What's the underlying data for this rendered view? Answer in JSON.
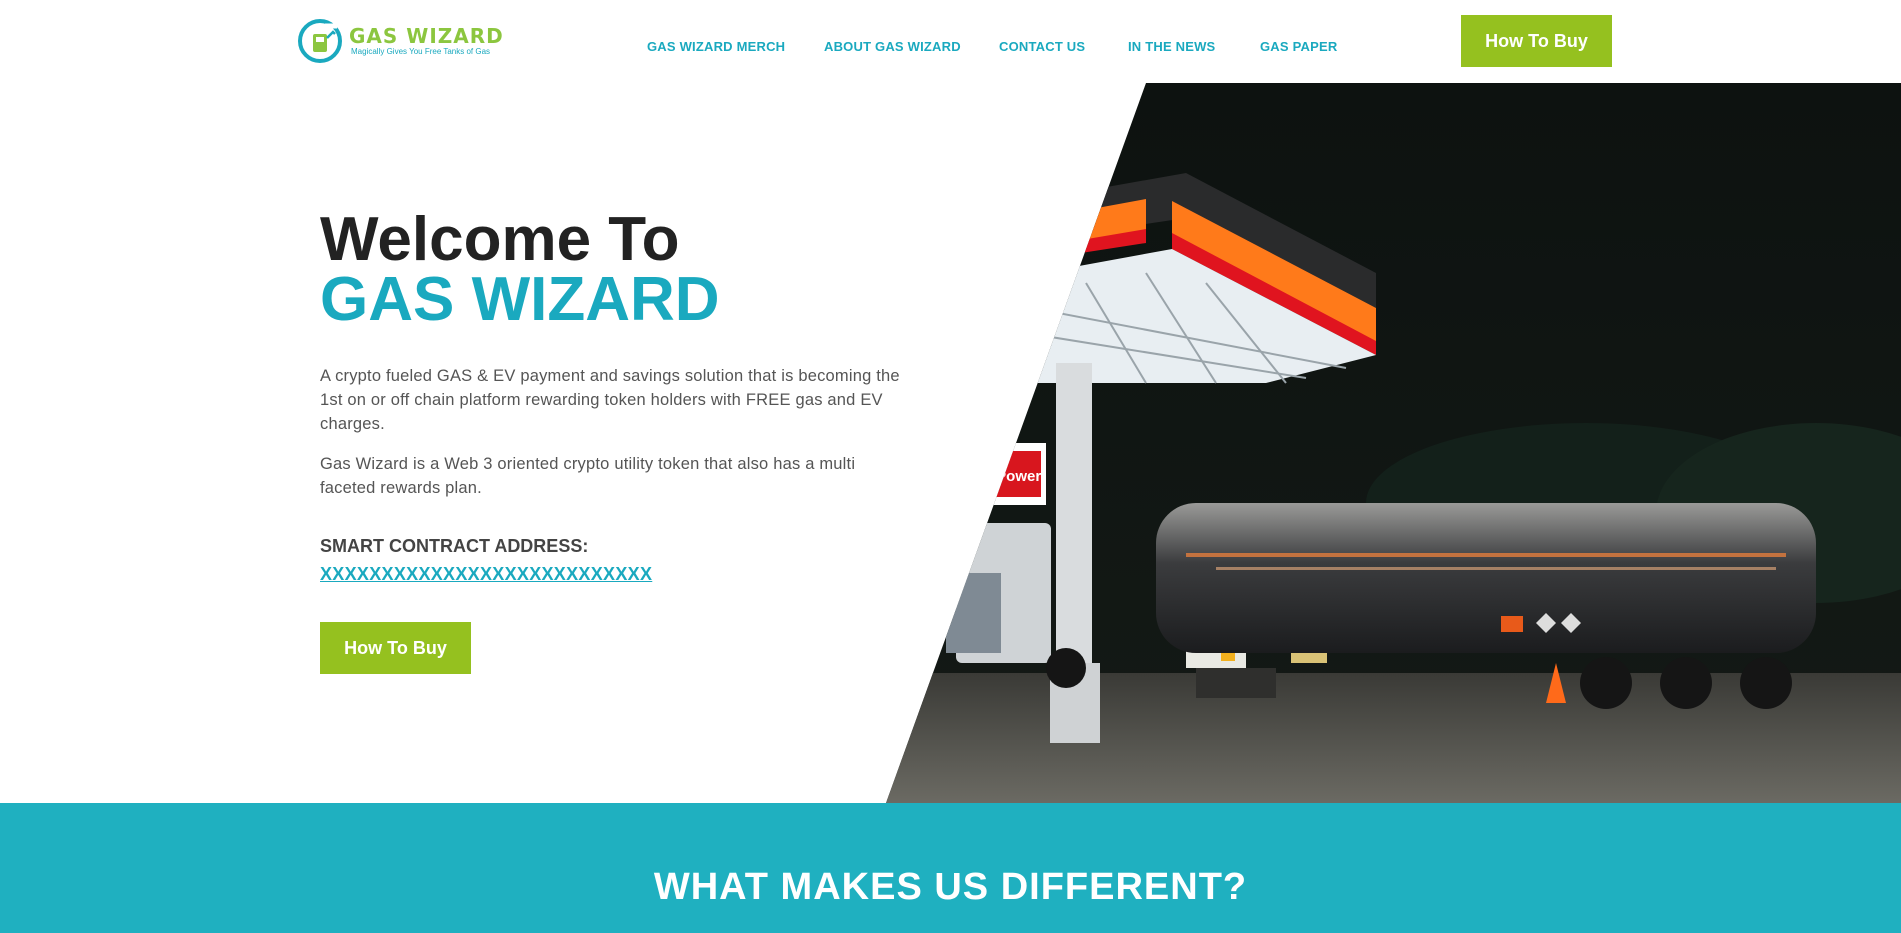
{
  "brand": {
    "name": "GAS WIZARD",
    "tagline": "Magically Gives You Free Tanks of Gas"
  },
  "nav": {
    "items": [
      {
        "label": "GAS WIZARD MERCH"
      },
      {
        "label": "ABOUT GAS WIZARD"
      },
      {
        "label": "CONTACT US"
      },
      {
        "label": "IN THE NEWS"
      },
      {
        "label": "GAS PAPER"
      }
    ],
    "cta_label": "How To Buy"
  },
  "hero": {
    "welcome": "Welcome To",
    "title": "GAS WIZARD",
    "paragraph1": "A crypto fueled GAS & EV payment and savings solution that is becoming the 1st on or off chain platform rewarding token holders with FREE gas and EV charges.",
    "paragraph2": "Gas Wizard is a Web 3 oriented crypto utility token that also has a multi faceted rewards plan.",
    "contract_label": "SMART CONTRACT ADDRESS:",
    "contract_value": "XXXXXXXXXXXXXXXXXXXXXXXXXXX",
    "cta_label": "How To Buy",
    "image_sign": "V-Power"
  },
  "section": {
    "title": "WHAT MAKES US DIFFERENT?"
  },
  "colors": {
    "accent": "#1aa9bf",
    "button": "#95c11f",
    "band": "#1fb0c0"
  }
}
